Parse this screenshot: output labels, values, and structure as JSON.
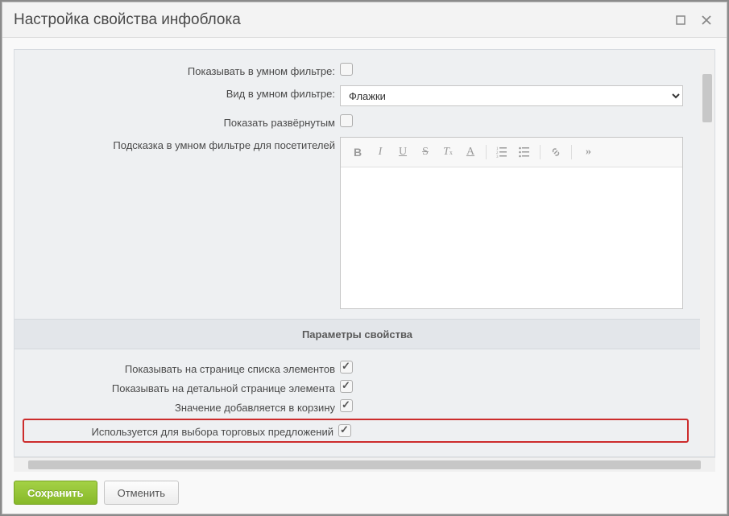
{
  "window": {
    "title": "Настройка свойства инфоблока"
  },
  "form": {
    "show_in_smart_filter": {
      "label": "Показывать в умном фильтре",
      "checked": false
    },
    "smart_filter_view": {
      "label": "Вид в умном фильтре",
      "value": "Флажки",
      "options": [
        "Флажки"
      ]
    },
    "show_expanded": {
      "label": "Показать развёрнутым",
      "checked": false
    },
    "hint_for_visitors": {
      "label": "Подсказка в умном фильтре для посетителей",
      "value": ""
    },
    "section_title": "Параметры свойства",
    "show_on_list": {
      "label": "Показывать на странице списка элементов",
      "checked": true
    },
    "show_on_detail": {
      "label": "Показывать на детальной странице элемента",
      "checked": true
    },
    "add_to_cart": {
      "label": "Значение добавляется в корзину",
      "checked": true
    },
    "use_for_offers": {
      "label": "Используется для выбора торговых предложений",
      "checked": true
    }
  },
  "buttons": {
    "save": "Сохранить",
    "cancel": "Отменить"
  }
}
